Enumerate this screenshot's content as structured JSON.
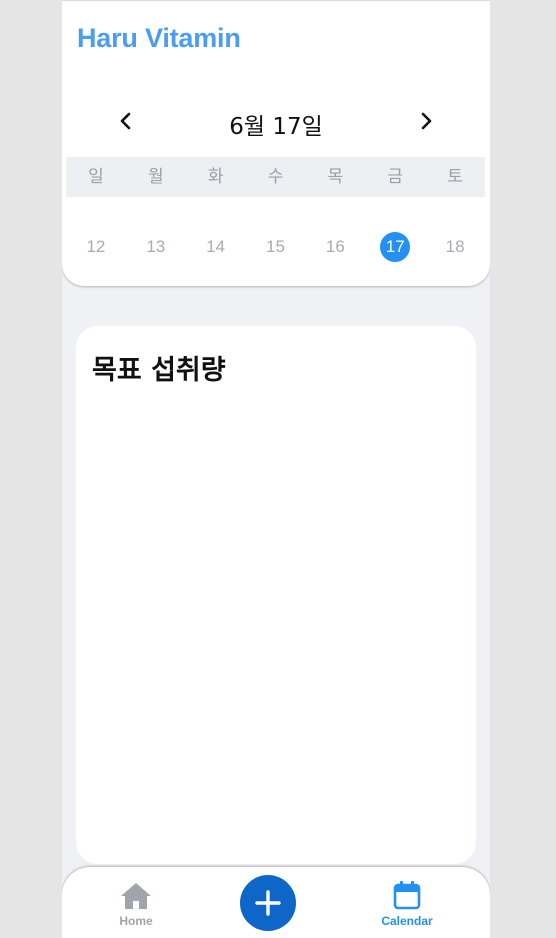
{
  "app": {
    "title": "Haru Vitamin"
  },
  "calendar": {
    "date_label": "6월 17일",
    "prev_icon": "chevron-left-icon",
    "next_icon": "chevron-right-icon",
    "weekdays": [
      "일",
      "월",
      "화",
      "수",
      "목",
      "금",
      "토"
    ],
    "dates": [
      "12",
      "13",
      "14",
      "15",
      "16",
      "17",
      "18"
    ],
    "selected_date": "17"
  },
  "goal": {
    "title": "목표 섭취량"
  },
  "bottom_nav": {
    "home_label": "Home",
    "home_icon": "home-icon",
    "add_icon": "plus-icon",
    "calendar_label": "Calendar",
    "calendar_icon": "calendar-icon",
    "active_tab": "Calendar"
  },
  "colors": {
    "accent": "#2490f3",
    "title": "#4a9df0",
    "add_button": "#0d66c8",
    "inactive": "#a1a4ab",
    "background": "#f0f1f5"
  }
}
